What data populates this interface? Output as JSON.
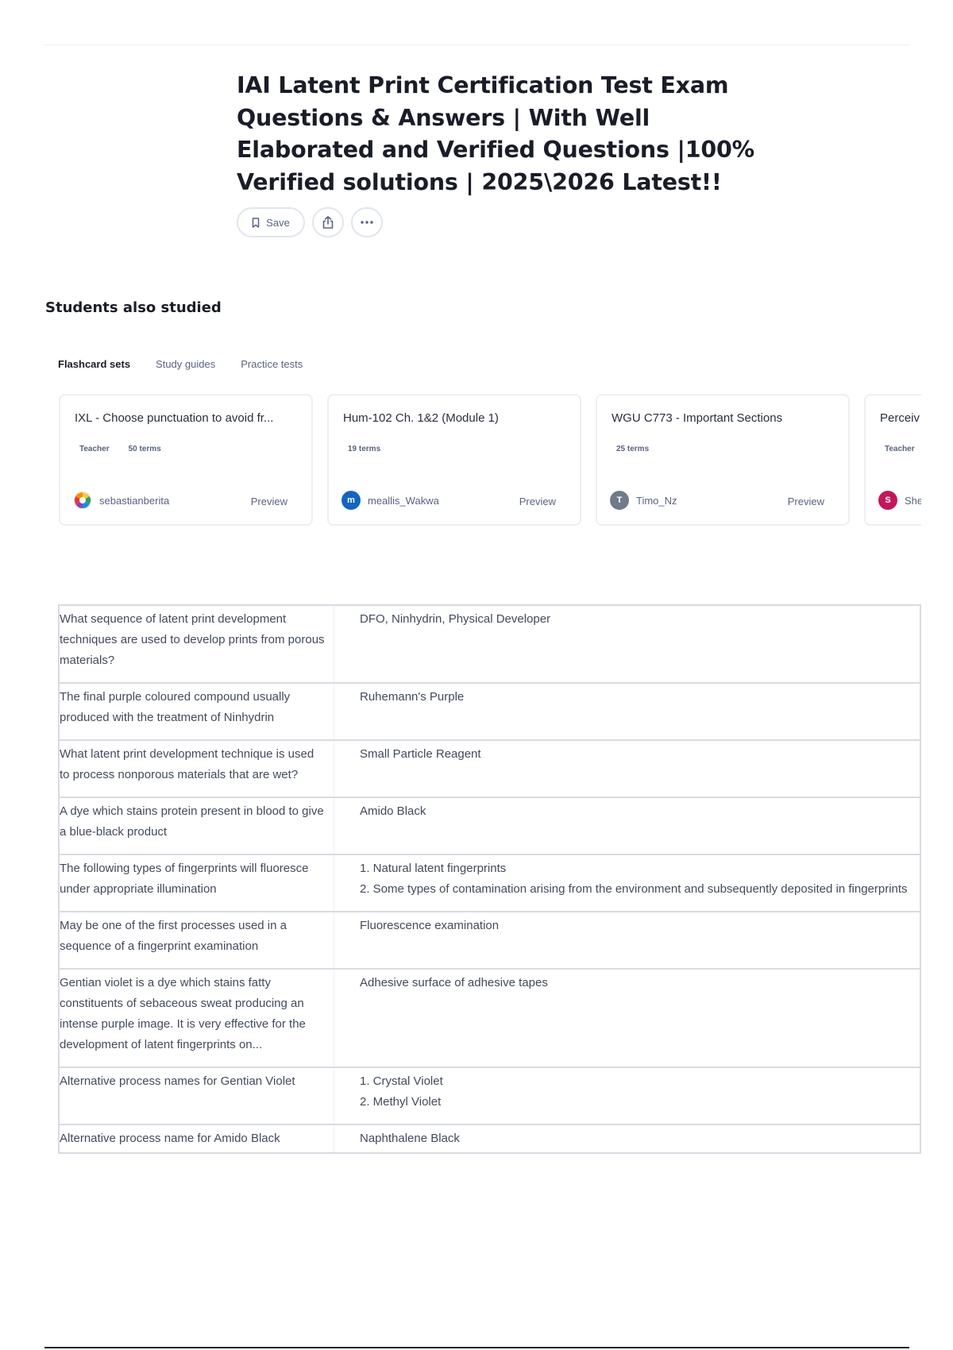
{
  "title": "IAI Latent Print Certification Test Exam Questions & Answers | With Well Elaborated and Verified Questions |100% Verified solutions | 2025\\2026 Latest!!",
  "actions": {
    "save_label": "Save",
    "icons": [
      "bookmark-icon",
      "share-icon",
      "more-icon"
    ]
  },
  "students_also_studied": {
    "heading": "Students also studied",
    "tabs": [
      {
        "label": "Flashcard sets",
        "active": true
      },
      {
        "label": "Study guides",
        "active": false
      },
      {
        "label": "Practice tests",
        "active": false
      }
    ],
    "cards": [
      {
        "title": "IXL - Choose punctuation to avoid fr...",
        "role": "Teacher",
        "terms": "50 terms",
        "username": "sebastianberita",
        "avatar_initial": "",
        "avatar_color": "#f2c94c",
        "preview_label": "Preview"
      },
      {
        "title": "Hum-102 Ch. 1&2 (Module 1)",
        "role": "",
        "terms": "19 terms",
        "username": "meallis_Wakwa",
        "avatar_initial": "m",
        "avatar_color": "#1565c0",
        "preview_label": "Preview"
      },
      {
        "title": "WGU C773 - Important Sections",
        "role": "",
        "terms": "25 terms",
        "username": "Timo_Nz",
        "avatar_initial": "T",
        "avatar_color": "#6f7b8a",
        "preview_label": "Preview"
      },
      {
        "title": "Perceiv",
        "role": "Teacher",
        "terms": "",
        "username": "She",
        "avatar_initial": "S",
        "avatar_color": "#c2185b",
        "preview_label": ""
      }
    ]
  },
  "qa": [
    {
      "term": "What sequence of latent print development techniques are used to develop prints from porous materials?",
      "definition": "DFO, Ninhydrin, Physical Developer"
    },
    {
      "term": "The final purple coloured compound usually produced with the treatment of Ninhydrin",
      "definition": "Ruhemann's Purple"
    },
    {
      "term": "What latent print development technique is used to process nonporous materials that are wet?",
      "definition": "Small Particle Reagent"
    },
    {
      "term": "A dye which stains protein present in blood to give a blue-black product",
      "definition": "Amido Black"
    },
    {
      "term": "The following types of fingerprints will fluoresce under appropriate illumination",
      "definition": "1. Natural latent fingerprints\n2. Some types of contamination arising from the environment and subsequently deposited in fingerprints"
    },
    {
      "term": "May be one of the first processes used in a sequence of a fingerprint examination",
      "definition": "Fluorescence examination"
    },
    {
      "term": "Gentian violet is a dye which stains fatty constituents of sebaceous sweat producing an intense purple image. It is very effective for the development of latent fingerprints on...",
      "definition": "Adhesive surface of adhesive tapes"
    },
    {
      "term": "Alternative process names for Gentian Violet",
      "definition": "1. Crystal Violet\n2. Methyl Violet"
    },
    {
      "term": "Alternative process name for Amido Black",
      "definition": "Naphthalene Black"
    }
  ]
}
